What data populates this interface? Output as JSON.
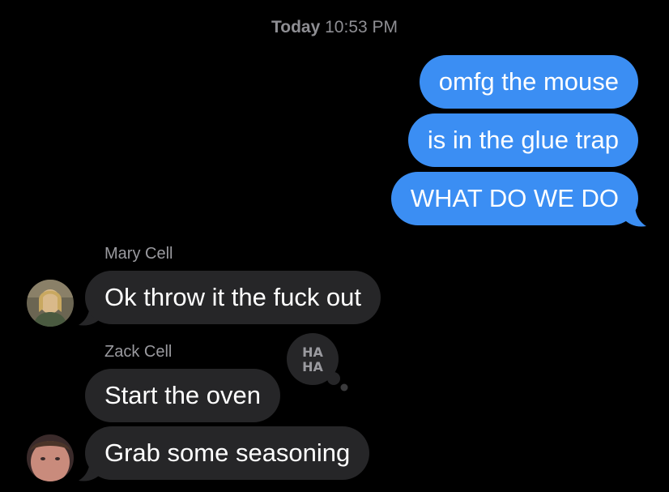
{
  "timestamp": {
    "day": "Today",
    "time": "10:53 PM"
  },
  "outgoing": [
    {
      "text": "omfg the mouse"
    },
    {
      "text": "is in the glue trap"
    },
    {
      "text": "WHAT DO WE DO"
    }
  ],
  "incoming": [
    {
      "sender": "Mary Cell",
      "text": "Ok throw it the fuck out"
    },
    {
      "sender": "Zack Cell",
      "text": "Start the oven"
    },
    {
      "sender": "",
      "text": "Grab some seasoning"
    }
  ],
  "tapback": {
    "icon": "haha-reaction-icon",
    "text_line1": "HA",
    "text_line2": "HA"
  },
  "colors": {
    "background": "#000000",
    "outgoing_bubble": "#3b8ef3",
    "incoming_bubble": "#262628",
    "meta_text": "#8e8e93"
  }
}
